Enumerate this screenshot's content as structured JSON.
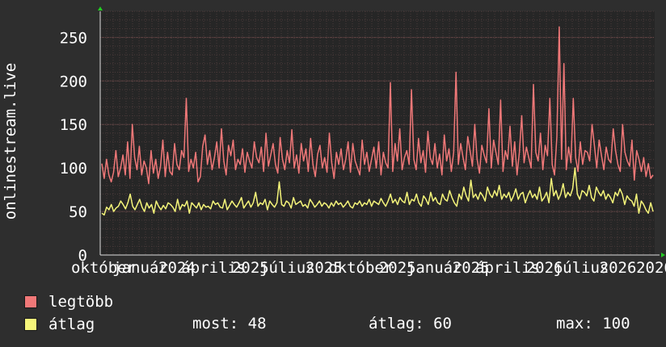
{
  "chart_data": {
    "type": "line",
    "ylabel": "onlinestream.live",
    "ylim": [
      0,
      280
    ],
    "yticks": [
      0,
      50,
      100,
      150,
      200,
      250
    ],
    "xtick_labels": [
      "október",
      "január",
      "2024",
      "április",
      "2025",
      "július",
      "2025",
      "október",
      "2025",
      "január",
      "2025",
      "április",
      "2026",
      "július",
      "2026",
      "2026"
    ],
    "grid": true,
    "series": [
      {
        "name": "legtöbb",
        "color": "#f07878",
        "values": [
          105,
          88,
          110,
          92,
          84,
          95,
          120,
          90,
          100,
          115,
          92,
          130,
          88,
          150,
          112,
          98,
          125,
          92,
          108,
          100,
          82,
          120,
          94,
          110,
          88,
          102,
          132,
          90,
          118,
          96,
          92,
          128,
          104,
          98,
          120,
          112,
          180,
          96,
          110,
          100,
          118,
          84,
          90,
          125,
          138,
          104,
          120,
          98,
          112,
          130,
          100,
          145,
          108,
          92,
          126,
          114,
          132,
          98,
          110,
          104,
          122,
          95,
          118,
          108,
          100,
          130,
          112,
          106,
          124,
          96,
          140,
          102,
          115,
          128,
          104,
          94,
          135,
          110,
          98,
          120,
          106,
          144,
          100,
          115,
          94,
          128,
          108,
          122,
          96,
          134,
          104,
          90,
          116,
          126,
          100,
          112,
          95,
          140,
          106,
          88,
          118,
          104,
          122,
          98,
          110,
          130,
          95,
          128,
          108,
          100,
          92,
          132,
          104,
          118,
          96,
          110,
          124,
          100,
          130,
          92,
          118,
          106,
          100,
          198,
          96,
          128,
          108,
          145,
          98,
          112,
          120,
          104,
          190,
          110,
          98,
          134,
          106,
          120,
          95,
          142,
          112,
          104,
          128,
          100,
          116,
          92,
          138,
          108,
          122,
          96,
          118,
          210,
          104,
          128,
          112,
          98,
          136,
          120,
          102,
          150,
          110,
          94,
          126,
          115,
          106,
          168,
          100,
          132,
          118,
          104,
          178,
          96,
          120,
          110,
          148,
          102,
          130,
          92,
          118,
          160,
          106,
          124,
          112,
          100,
          196,
          118,
          108,
          140,
          98,
          126,
          114,
          180,
          104,
          92,
          136,
          262,
          110,
          220,
          98,
          124,
          106,
          180,
          112,
          96,
          130,
          104,
          120,
          118,
          108,
          150,
          126,
          100,
          132,
          114,
          98,
          124,
          110,
          106,
          145,
          120,
          104,
          96,
          150,
          118,
          108,
          102,
          132,
          86,
          120,
          110,
          96,
          112,
          90,
          105,
          88,
          92
        ],
        "line_width": 1.5
      },
      {
        "name": "átlag",
        "color": "#f5f57a",
        "values": [
          48,
          46,
          55,
          52,
          58,
          50,
          54,
          56,
          62,
          58,
          53,
          60,
          70,
          56,
          52,
          58,
          64,
          55,
          50,
          60,
          54,
          58,
          48,
          62,
          56,
          52,
          57,
          53,
          60,
          58,
          55,
          50,
          64,
          52,
          58,
          56,
          62,
          48,
          60,
          57,
          54,
          60,
          52,
          58,
          55,
          56,
          53,
          62,
          58,
          60,
          55,
          54,
          64,
          52,
          57,
          62,
          58,
          55,
          60,
          66,
          54,
          58,
          62,
          55,
          60,
          72,
          56,
          60,
          58,
          64,
          52,
          62,
          58,
          55,
          60,
          84,
          58,
          56,
          62,
          60,
          54,
          66,
          58,
          60,
          62,
          56,
          58,
          54,
          64,
          60,
          55,
          58,
          62,
          56,
          60,
          58,
          54,
          60,
          56,
          62,
          58,
          60,
          55,
          58,
          62,
          56,
          54,
          60,
          58,
          62,
          56,
          60,
          58,
          64,
          56,
          62,
          60,
          58,
          65,
          60,
          56,
          62,
          70,
          60,
          64,
          58,
          66,
          62,
          60,
          72,
          58,
          64,
          62,
          70,
          60,
          56,
          68,
          64,
          58,
          72,
          62,
          66,
          60,
          58,
          70,
          64,
          62,
          74,
          66,
          60,
          56,
          70,
          64,
          78,
          68,
          62,
          86,
          66,
          70,
          64,
          72,
          68,
          62,
          78,
          70,
          66,
          74,
          68,
          80,
          64,
          70,
          66,
          72,
          62,
          68,
          76,
          64,
          70,
          72,
          60,
          68,
          74,
          66,
          70,
          64,
          78,
          62,
          66,
          72,
          60,
          88,
          68,
          74,
          64,
          70,
          82,
          66,
          72,
          68,
          76,
          100,
          70,
          64,
          74,
          72,
          68,
          80,
          66,
          62,
          78,
          72,
          68,
          74,
          64,
          70,
          66,
          60,
          72,
          68,
          76,
          70,
          58,
          68,
          64,
          62,
          56,
          70,
          48,
          62,
          58,
          52,
          48,
          60,
          50
        ],
        "line_width": 1.5
      }
    ]
  },
  "legend": {
    "items": [
      {
        "label": "legtöbb",
        "color": "#f07878"
      },
      {
        "label": "átlag",
        "color": "#f5f57a"
      }
    ]
  },
  "stats": {
    "most": "most: 48",
    "atlag": "átlag: 60",
    "max": "max: 100"
  }
}
